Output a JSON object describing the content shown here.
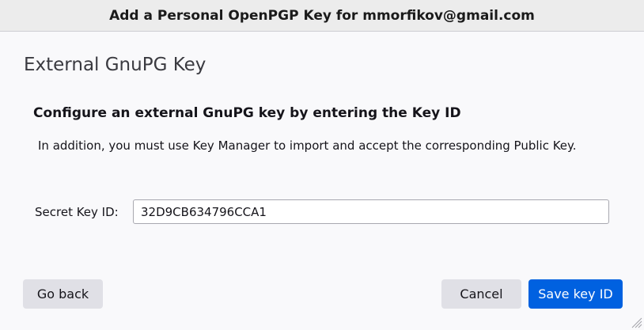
{
  "window": {
    "title": "Add a Personal OpenPGP Key for mmorfikov@gmail.com"
  },
  "section": {
    "title": "External GnuPG Key"
  },
  "content": {
    "heading": "Configure an external GnuPG key by entering the Key ID",
    "description": "In addition, you must use Key Manager to import and accept the corresponding Public Key."
  },
  "form": {
    "secret_key_label": "Secret Key ID:",
    "secret_key_value": "32D9CB634796CCA1"
  },
  "buttons": {
    "go_back": "Go back",
    "cancel": "Cancel",
    "save_key_id": "Save key ID"
  },
  "colors": {
    "primary": "#0061e0",
    "secondary": "#e0e0e6"
  },
  "icons": {
    "resize_grip": "resize-grip-icon"
  }
}
